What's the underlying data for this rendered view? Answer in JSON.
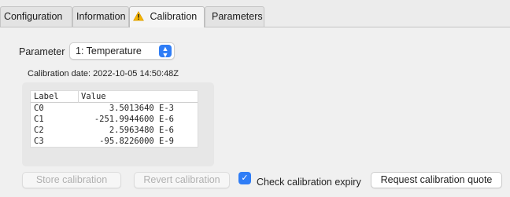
{
  "tabs": [
    {
      "label": "Configuration",
      "active": false
    },
    {
      "label": "Information",
      "active": false
    },
    {
      "label": "Calibration",
      "active": true,
      "icon": "warning-icon"
    },
    {
      "label": "Parameters",
      "active": false
    }
  ],
  "parameter": {
    "label": "Parameter",
    "selected": "1: Temperature"
  },
  "calibration_date": "Calibration date: 2022-10-05 14:50:48Z",
  "table": {
    "headers": [
      "Label",
      "Value"
    ],
    "rows": [
      {
        "label": "C0",
        "value": "3.5013640 E-3"
      },
      {
        "label": "C1",
        "value": "-251.9944600 E-6"
      },
      {
        "label": "C2",
        "value": "2.5963480 E-6"
      },
      {
        "label": "C3",
        "value": "-95.8226000 E-9"
      }
    ]
  },
  "buttons": {
    "store": "Store calibration",
    "revert": "Revert calibration",
    "request_quote": "Request calibration quote"
  },
  "check_expiry": {
    "label": "Check calibration expiry",
    "checked": true
  },
  "colors": {
    "accent": "#2f7df6",
    "warning": "#f5b400"
  }
}
